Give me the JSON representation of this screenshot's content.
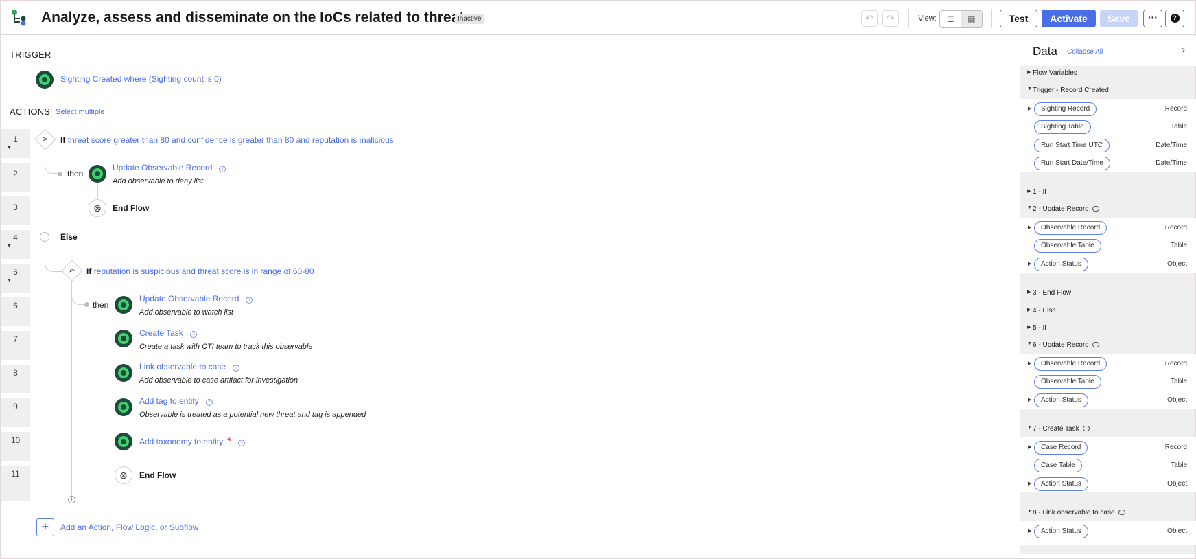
{
  "header": {
    "title": "Analyze, assess and disseminate on the IoCs related to threat",
    "status": "Inactive",
    "undo_icon": "undo-icon",
    "redo_icon": "redo-icon",
    "view_label": "View:",
    "buttons": {
      "test": "Test",
      "activate": "Activate",
      "save": "Save",
      "more": "···",
      "help": "?"
    }
  },
  "canvas": {
    "trigger_label": "TRIGGER",
    "trigger_text": "Sighting Created where (Sighting count is 0)",
    "actions_label": "ACTIONS",
    "select_multiple": "Select multiple",
    "rows": [
      "1",
      "2",
      "3",
      "4",
      "5",
      "6",
      "7",
      "8",
      "9",
      "10",
      "11"
    ],
    "if1": {
      "keyword": "If",
      "condition": "threat score greater than 80 and confidence is greater than 80 and reputation is malicious"
    },
    "then_label": "then",
    "step2": {
      "title": "Update Observable Record",
      "desc": "Add observable to deny list"
    },
    "end_flow": "End Flow",
    "else_label": "Else",
    "if2": {
      "keyword": "If",
      "condition": "reputation is suspicious and threat score is in range of 60-80"
    },
    "step6": {
      "title": "Update Observable Record",
      "desc": "Add observable to watch list"
    },
    "step7": {
      "title": "Create Task",
      "desc": "Create a task with CTI team to track this observable"
    },
    "step8": {
      "title": "Link observable to case",
      "desc": "Add observable to case artifact for investigation"
    },
    "step9": {
      "title": "Add tag to entity",
      "desc": "Observable is treated as a potential new threat and tag is appended"
    },
    "step10": {
      "title": "Add taxonomy to entity",
      "required": "*"
    },
    "add_action": "Add an Action, Flow Logic, or Subflow"
  },
  "data_panel": {
    "title": "Data",
    "collapse_all": "Collapse All",
    "flow_variables": "Flow Variables",
    "trigger_section": "Trigger - Record Created",
    "trigger_pills": [
      {
        "label": "Sighting Record",
        "type": "Record"
      },
      {
        "label": "Sighting Table",
        "type": "Table"
      },
      {
        "label": "Run Start Time UTC",
        "type": "Date/Time"
      },
      {
        "label": "Run Start Date/Time",
        "type": "Date/Time"
      }
    ],
    "s1": "1 - If",
    "s2": "2 - Update Record",
    "s2_pills": [
      {
        "label": "Observable Record",
        "type": "Record"
      },
      {
        "label": "Observable Table",
        "type": "Table"
      },
      {
        "label": "Action Status",
        "type": "Object"
      }
    ],
    "s3": "3 - End Flow",
    "s4": "4 - Else",
    "s5": "5 - If",
    "s6": "6 - Update Record",
    "s6_pills": [
      {
        "label": "Observable Record",
        "type": "Record"
      },
      {
        "label": "Observable Table",
        "type": "Table"
      },
      {
        "label": "Action Status",
        "type": "Object"
      }
    ],
    "s7": "7 - Create Task",
    "s7_pills": [
      {
        "label": "Case Record",
        "type": "Record"
      },
      {
        "label": "Case Table",
        "type": "Table"
      },
      {
        "label": "Action Status",
        "type": "Object"
      }
    ],
    "s8": "8 - Link observable to case",
    "s8_pills": [
      {
        "label": "Action Status",
        "type": "Object"
      }
    ]
  }
}
